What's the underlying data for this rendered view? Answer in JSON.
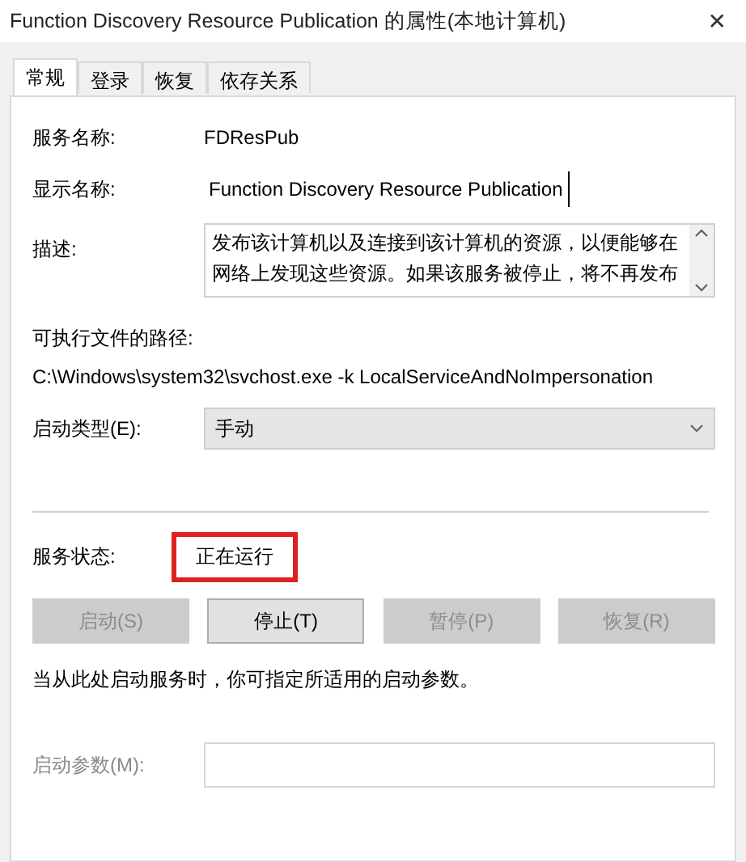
{
  "window": {
    "title": "Function Discovery Resource Publication 的属性(本地计算机)",
    "close": "✕"
  },
  "tabs": [
    {
      "label": "常规",
      "selected": true
    },
    {
      "label": "登录",
      "selected": false
    },
    {
      "label": "恢复",
      "selected": false
    },
    {
      "label": "依存关系",
      "selected": false
    }
  ],
  "service_name": {
    "label": "服务名称:",
    "value": "FDResPub"
  },
  "display_name": {
    "label": "显示名称:",
    "value": "Function Discovery Resource Publication"
  },
  "description": {
    "label": "描述:",
    "value": "发布该计算机以及连接到该计算机的资源，以便能够在网络上发现这些资源。如果该服务被停止，将不再发布"
  },
  "path": {
    "label": "可执行文件的路径:",
    "value": "C:\\Windows\\system32\\svchost.exe -k LocalServiceAndNoImpersonation"
  },
  "startup_type": {
    "label": "启动类型(E):",
    "value": "手动"
  },
  "service_status": {
    "label": "服务状态:",
    "value": "正在运行",
    "highlighted": true
  },
  "buttons": [
    {
      "label": "启动(S)",
      "disabled": true
    },
    {
      "label": "停止(T)",
      "disabled": false
    },
    {
      "label": "暂停(P)",
      "disabled": true
    },
    {
      "label": "恢复(R)",
      "disabled": true
    }
  ],
  "hint": "当从此处启动服务时，你可指定所适用的启动参数。",
  "start_params": {
    "label": "启动参数(M):",
    "disabled": true
  }
}
